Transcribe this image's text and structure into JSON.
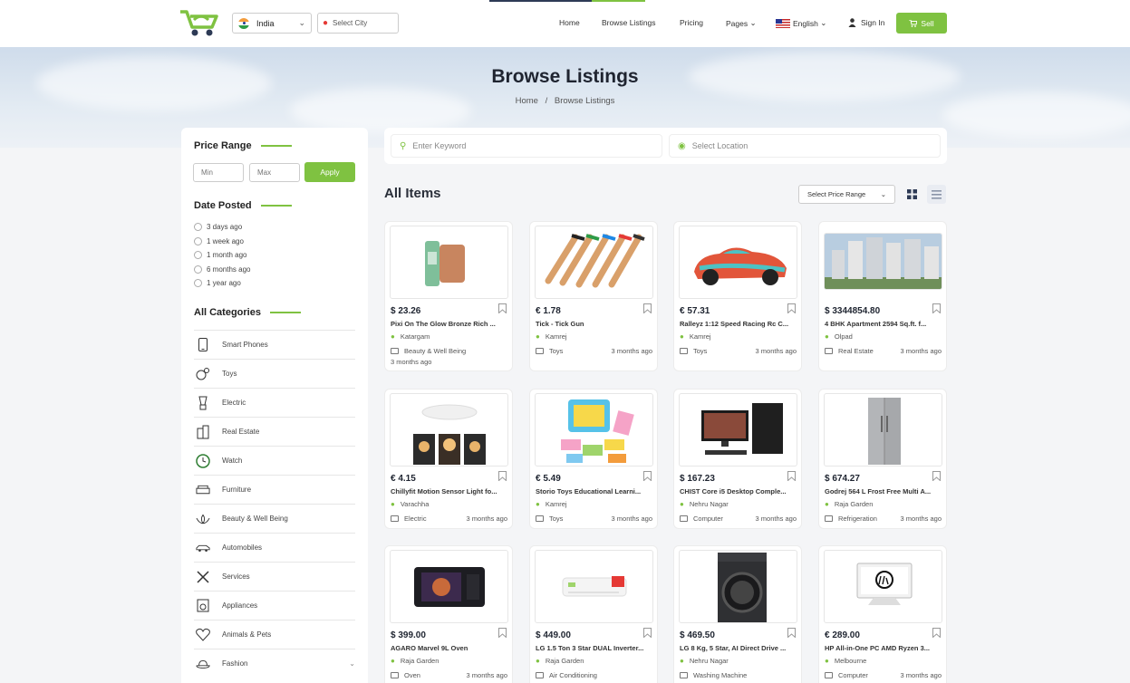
{
  "header": {
    "country": "India",
    "city_placeholder": "Select City",
    "nav": [
      "Home",
      "Browse Listings",
      "Pricing",
      "Pages",
      "English",
      "Sign In"
    ],
    "sell": "Sell"
  },
  "hero": {
    "title": "Browse Listings",
    "breadcrumb": [
      "Home",
      "/",
      "Browse Listings"
    ]
  },
  "sidebar": {
    "price_title": "Price Range",
    "min_placeholder": "Min",
    "max_placeholder": "Max",
    "apply": "Apply",
    "date_title": "Date Posted",
    "date_options": [
      "3 days ago",
      "1 week ago",
      "1 month ago",
      "6 months ago",
      "1 year ago"
    ],
    "categories_title": "All Categories",
    "categories": [
      "Smart Phones",
      "Toys",
      "Electric",
      "Real Estate",
      "Watch",
      "Furniture",
      "Beauty & Well Being",
      "Automobiles",
      "Services",
      "Appliances",
      "Animals & Pets",
      "Fashion"
    ]
  },
  "search": {
    "keyword_placeholder": "Enter Keyword",
    "location_placeholder": "Select Location"
  },
  "listing": {
    "heading": "All Items",
    "price_select": "Select Price Range"
  },
  "items": [
    {
      "price": "$ 23.26",
      "title": "Pixi On The Glow Bronze Rich ...",
      "location": "Katargam",
      "category": "Beauty & Well Being",
      "time": "3 months ago"
    },
    {
      "price": "€ 1.78",
      "title": "Tick - Tick Gun",
      "location": "Kamrej",
      "category": "Toys",
      "time": "3 months ago"
    },
    {
      "price": "€ 57.31",
      "title": "Ralleyz 1:12 Speed Racing Rc C...",
      "location": "Kamrej",
      "category": "Toys",
      "time": "3 months ago"
    },
    {
      "price": "$ 3344854.80",
      "title": "4 BHK Apartment 2594 Sq.ft. f...",
      "location": "Olpad",
      "category": "Real Estate",
      "time": "3 months ago"
    },
    {
      "price": "€ 4.15",
      "title": "Chillyfit Motion Sensor Light fo...",
      "location": "Varachha",
      "category": "Electric",
      "time": "3 months ago"
    },
    {
      "price": "€ 5.49",
      "title": "Storio Toys Educational Learni...",
      "location": "Kamrej",
      "category": "Toys",
      "time": "3 months ago"
    },
    {
      "price": "$ 167.23",
      "title": "CHIST Core i5 Desktop Comple...",
      "location": "Nehru Nagar",
      "category": "Computer",
      "time": "3 months ago"
    },
    {
      "price": "$ 674.27",
      "title": "Godrej 564 L Frost Free Multi A...",
      "location": "Raja Garden",
      "category": "Refrigeration",
      "time": "3 months ago"
    },
    {
      "price": "$ 399.00",
      "title": "AGARO Marvel 9L Oven",
      "location": "Raja Garden",
      "category": "Oven",
      "time": "3 months ago"
    },
    {
      "price": "$ 449.00",
      "title": "LG 1.5 Ton 3 Star DUAL Inverter...",
      "location": "Raja Garden",
      "category": "Air Conditioning",
      "time": ""
    },
    {
      "price": "$ 469.50",
      "title": "LG 8 Kg, 5 Star, AI Direct Drive ...",
      "location": "Nehru Nagar",
      "category": "Washing Machine",
      "time": ""
    },
    {
      "price": "€ 289.00",
      "title": "HP All-in-One PC AMD Ryzen 3...",
      "location": "Melbourne",
      "category": "Computer",
      "time": "3 months ago"
    }
  ],
  "colors": {
    "accent": "#7fc241",
    "dark": "#2a2f3a"
  }
}
